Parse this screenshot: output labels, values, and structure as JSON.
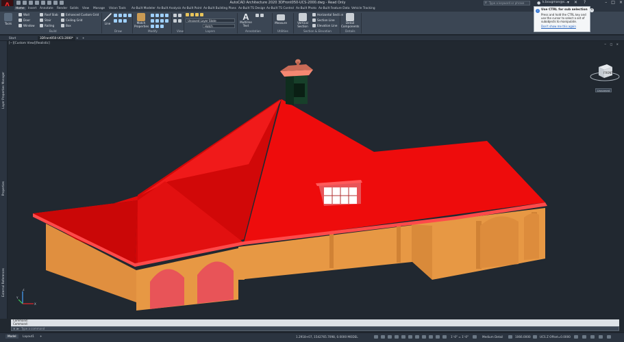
{
  "titlebar": {
    "app_logo": "A",
    "title": "AutoCAD Architecture 2020   3DFront050-UCS-2000.dwg - Read Only",
    "search_placeholder": "Type a keyword or phrase",
    "user": "k.bougman@s...",
    "controls": [
      "–",
      "□",
      "×"
    ]
  },
  "ribbon_tabs": [
    "Home",
    "Insert",
    "Annotate",
    "Render",
    "Solids",
    "View",
    "Manage",
    "Vision Tools",
    "As-Built Modeler",
    "As-Built Analysis",
    "As-Built Point",
    "As-Built Building Plans",
    "As-Built TS Design",
    "As-Built TS Control",
    "As-Built Photo",
    "As-Built Feature Data",
    "Vehicle Tracking"
  ],
  "ribbon": {
    "build": {
      "label": "Build",
      "tools": "Tools",
      "items": [
        "Wall",
        "Door",
        "Window",
        "Roof Slab",
        "Stair",
        "Railing",
        "Enhanced Custom Grid",
        "Ceiling Grid",
        "Box"
      ]
    },
    "draw": {
      "label": "Draw",
      "line": "Line"
    },
    "modify": {
      "label": "Modify",
      "match_properties": "Match Properties"
    },
    "view": {
      "label": "View"
    },
    "layers": {
      "label": "Layers",
      "layer_state": "Unsaved Layer State",
      "layer_name": "Hatch"
    },
    "annotation": {
      "label": "Annotation",
      "multiline_text": "Multiline Text"
    },
    "utilities": {
      "label": "Utilities",
      "measure": "Measure"
    },
    "section": {
      "label": "Section & Elevation",
      "vertical_section": "Vertical Section",
      "items": [
        "Horizontal Section",
        "Section Line",
        "Elevation Line"
      ]
    },
    "details": {
      "label": "Details",
      "detail_components": "Detail Components"
    }
  },
  "tooltip": {
    "title": "Use CTRL for sub selection",
    "body": "Press and hold the CTRL key and use the cursor to select a set of subobjects to manipulate.",
    "link": "Don't show me this again",
    "info_icon": "i",
    "close_icon": "×"
  },
  "file_tabs": {
    "start": "Start",
    "file": "3DFront050-UCS-2000*",
    "close": "×",
    "add": "+"
  },
  "viewport": {
    "label": "[−][Custom View][Realistic]",
    "controls": "− □ ×",
    "viewcube_face": "FRONT",
    "unnamed": "Unnamed"
  },
  "left_palettes": [
    "Layer Properties Manager",
    "Properties",
    "External References"
  ],
  "ucs": {
    "y": "Y",
    "z": "Z",
    "x": "X"
  },
  "command": {
    "history": [
      "Command:",
      "Command:"
    ],
    "prompt": "×  ≫",
    "placeholder": "Type a command"
  },
  "statusbar": {
    "model_tab": "Model",
    "layout_tab": "Layout1",
    "add": "+",
    "coords": "1.2918+07, 1542765.7098, 0.0000   MODEL",
    "scale": "1'-0\" = 1'-0\"",
    "detail": "Medium Detail",
    "elevation": "1066.0000",
    "ucs": "UCS Z Offset=0.0000"
  },
  "colors": {
    "roof": "#ee0c0c",
    "wall": "#e79844",
    "door": "#e85458",
    "background": "#212830"
  }
}
